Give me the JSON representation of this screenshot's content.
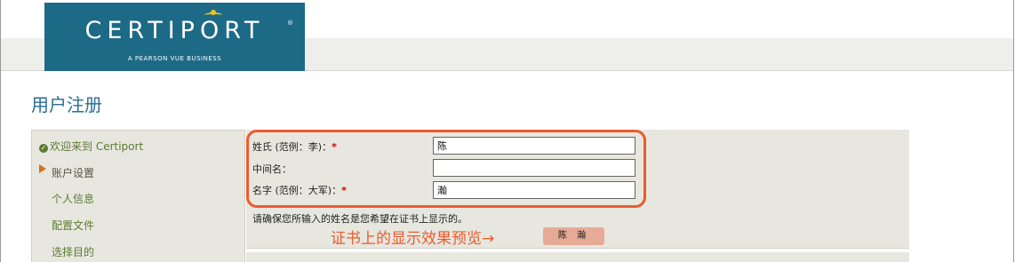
{
  "header": {
    "logo_text": "CERTIPORT",
    "logo_tagline": "A PEARSON VUE BUSINESS",
    "logo_trademark": "®"
  },
  "page": {
    "title": "用户注册"
  },
  "sidebar": {
    "items": [
      {
        "label": "欢迎来到 Certiport",
        "state": "completed"
      },
      {
        "label": "账户设置",
        "state": "current"
      },
      {
        "label": "个人信息",
        "state": "pending"
      },
      {
        "label": "配置文件",
        "state": "pending"
      },
      {
        "label": "选择目的",
        "state": "pending"
      }
    ]
  },
  "form": {
    "fields": [
      {
        "label": "姓氏 (范例：李)：",
        "required": true,
        "value": "陈"
      },
      {
        "label": "中间名：",
        "required": false,
        "value": ""
      },
      {
        "label": "名字 (范例：大军)：",
        "required": true,
        "value": "瀚"
      }
    ],
    "required_marker": "*",
    "notice": "请确保您所输入的姓名是您希望在证书上显示的。",
    "preview_caption": "证书上的显示效果预览→",
    "preview_name": "陈 瀚"
  },
  "colors": {
    "brand": "#1d6a87",
    "highlight": "#ee5a2c",
    "link_green": "#5c7a31",
    "panel_bg": "#e7e7df"
  }
}
